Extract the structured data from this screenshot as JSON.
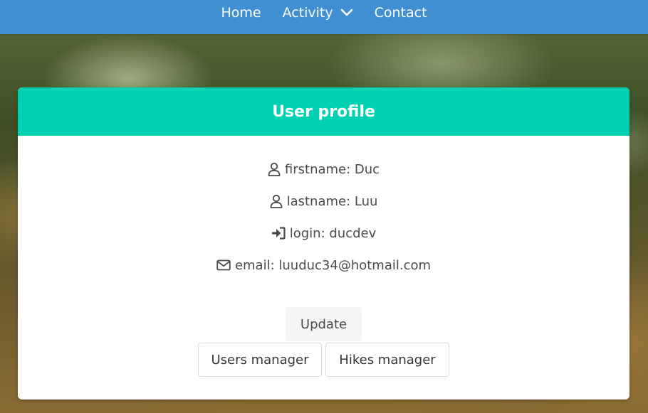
{
  "nav": {
    "home": "Home",
    "activity": "Activity",
    "contact": "Contact"
  },
  "profile": {
    "title": "User profile",
    "firstname": "firstname: Duc",
    "lastname": "lastname: Luu",
    "login": "login: ducdev",
    "email": "email: luuduc34@hotmail.com"
  },
  "buttons": {
    "update": "Update",
    "users_manager": "Users manager",
    "hikes_manager": "Hikes manager"
  },
  "icons": {
    "firstname": "user-icon",
    "lastname": "user-icon",
    "login": "sign-in-icon",
    "email": "envelope-icon",
    "activity": "chevron-down-icon"
  },
  "colors": {
    "navbar": "#3f8fd2",
    "card_header": "#00d1b2",
    "text": "#4a4a4a"
  }
}
